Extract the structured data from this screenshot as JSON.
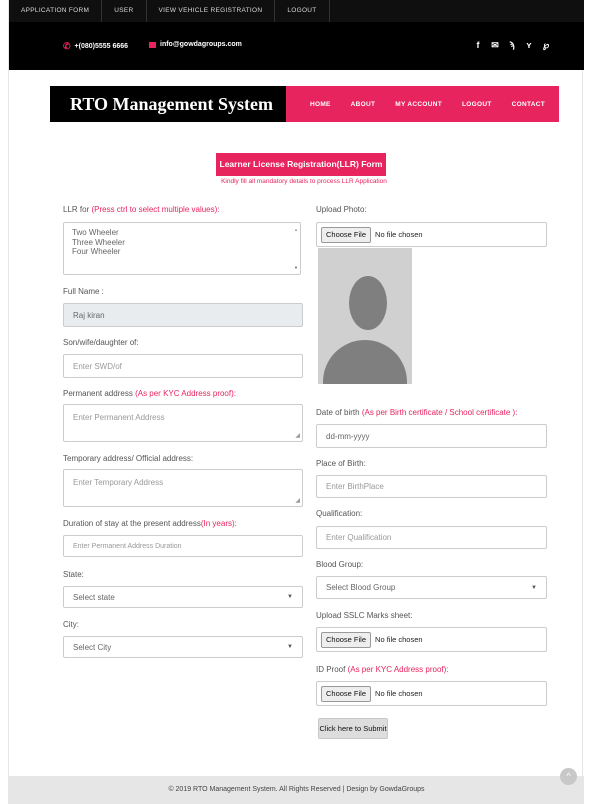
{
  "topbar": {
    "items": [
      "APPLICATION FORM",
      "USER",
      "VIEW VEHICLE REGISTRATION",
      "LOGOUT"
    ]
  },
  "contact": {
    "phone": "+(080)5555 6666",
    "email": "info@gowdagroups.com"
  },
  "social_icons": [
    "facebook-icon",
    "email-icon",
    "rss-icon",
    "twitter-icon",
    "pinterest-icon"
  ],
  "brand": {
    "title": "RTO Management System"
  },
  "nav": {
    "items": [
      "HOME",
      "ABOUT",
      "MY ACCOUNT",
      "LOGOUT",
      "CONTACT"
    ]
  },
  "form": {
    "title": "Learner License Registration(LLR) Form",
    "subtitle": "Kindly fill all mandatory details to process LLR Application",
    "llr_for": {
      "label": "LLR for",
      "hint": "(Press ctrl to select multiple values):",
      "options": [
        "Two Wheeler",
        "Three Wheeler",
        "Four Wheeler"
      ]
    },
    "full_name": {
      "label": "Full Name :",
      "value": "Raj kiran"
    },
    "relation": {
      "label": "Son/wife/daughter of:",
      "placeholder": "Enter SWD/of"
    },
    "permanent_address": {
      "label": "Permanent address",
      "hint": "(As per KYC Address proof):",
      "placeholder": "Enter Permanent Address"
    },
    "temporary_address": {
      "label": "Temporary address/ Official address:",
      "placeholder": "Enter Temporary Address"
    },
    "duration": {
      "label": "Duration of stay at the present address",
      "hint": "(In years):",
      "placeholder": "Enter Permanent Address Duration"
    },
    "state": {
      "label": "State:",
      "selected": "Select state"
    },
    "city": {
      "label": "City:",
      "selected": "Select City"
    },
    "upload_photo": {
      "label": "Upload Photo:",
      "button": "Choose File",
      "status": "No file chosen"
    },
    "dob": {
      "label": "Date of birth",
      "hint": "(As per Birth certificate / School certificate ):",
      "placeholder": "dd-mm-yyyy"
    },
    "place_of_birth": {
      "label": "Place of Birth:",
      "placeholder": "Enter BirthPlace"
    },
    "qualification": {
      "label": "Qualification:",
      "placeholder": "Enter Qualification"
    },
    "blood_group": {
      "label": "Blood Group:",
      "selected": "Select Blood Group"
    },
    "sslc": {
      "label": "Upload SSLC Marks sheet:",
      "button": "Choose File",
      "status": "No file chosen"
    },
    "id_proof": {
      "label": "ID Proof",
      "hint": "(As per KYC Address proof):",
      "button": "Choose File",
      "status": "No file chosen"
    },
    "submit": "Click here to Submit"
  },
  "footer": {
    "text": "© 2019 RTO Management System. All Rights Reserved | Design by GowdaGroups"
  }
}
